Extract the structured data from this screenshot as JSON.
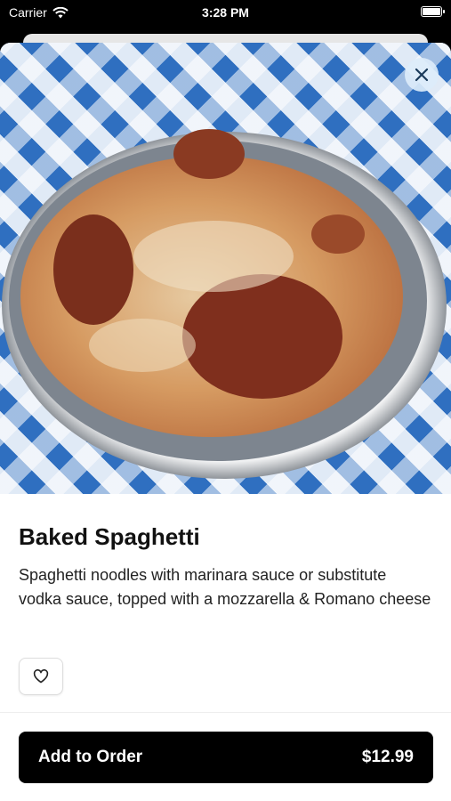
{
  "status_bar": {
    "carrier": "Carrier",
    "time": "3:28 PM",
    "wifi_icon": "wifi-icon",
    "battery_icon": "battery-icon"
  },
  "item": {
    "image_icon": "food-photo",
    "name": "Baked Spaghetti",
    "description": "Spaghetti noodles with marinara sauce or substitute vodka sauce, topped with a mozzarella & Romano cheese"
  },
  "actions": {
    "close_icon": "close-icon",
    "favorite_icon": "heart-icon",
    "add_label": "Add to Order",
    "price": "$12.99"
  },
  "colors": {
    "button_bg": "#000000",
    "checker_blue": "#2f6fc0",
    "close_bg": "#dcebfa"
  }
}
